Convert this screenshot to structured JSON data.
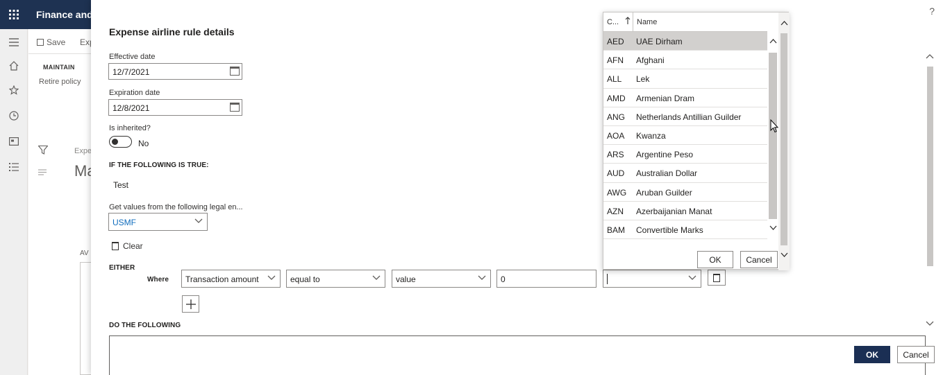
{
  "app": {
    "title": "Finance and",
    "waffle_icon": "waffle-icon"
  },
  "rail": {
    "icons": [
      "hamburger-icon",
      "home-icon",
      "star-icon",
      "clock-icon",
      "workspace-icon",
      "list-icon"
    ]
  },
  "background": {
    "toolbar": {
      "save_label": "Save",
      "exp_label": "Exp"
    },
    "maintain_label": "MAINTAIN",
    "retire_label": "Retire policy",
    "breadcrumb": "Expe",
    "heading": "Ma",
    "av_label": "AV"
  },
  "dialog": {
    "help": "?",
    "title": "Expense airline rule details",
    "effective_date": {
      "label": "Effective date",
      "value": "12/7/2021"
    },
    "expiration_date": {
      "label": "Expiration date",
      "value": "12/8/2021"
    },
    "is_inherited": {
      "label": "Is inherited?",
      "value": "No"
    },
    "if_true_label": "IF THE FOLLOWING IS TRUE:",
    "condition_name": "Test",
    "legal_entity": {
      "label": "Get values from the following legal en...",
      "value": "USMF"
    },
    "clear_label": "Clear",
    "either_label": "EITHER",
    "where_label": "Where",
    "condition": {
      "field": "Transaction amount",
      "operator": "equal to",
      "value_type": "value",
      "value": "0",
      "currency": ""
    },
    "add_icon": "plus-icon",
    "do_following_label": "DO THE FOLLOWING",
    "ok_label": "OK",
    "cancel_label": "Cancel"
  },
  "lookup": {
    "columns": {
      "code": "C...",
      "name": "Name"
    },
    "sort_icon": "sort-up-icon",
    "selected_index": 0,
    "rows": [
      {
        "code": "AED",
        "name": "UAE Dirham"
      },
      {
        "code": "AFN",
        "name": "Afghani"
      },
      {
        "code": "ALL",
        "name": "Lek"
      },
      {
        "code": "AMD",
        "name": "Armenian Dram"
      },
      {
        "code": "ANG",
        "name": "Netherlands Antillian Guilder"
      },
      {
        "code": "AOA",
        "name": "Kwanza"
      },
      {
        "code": "ARS",
        "name": "Argentine Peso"
      },
      {
        "code": "AUD",
        "name": "Australian Dollar"
      },
      {
        "code": "AWG",
        "name": "Aruban Guilder"
      },
      {
        "code": "AZN",
        "name": "Azerbaijanian Manat"
      },
      {
        "code": "BAM",
        "name": "Convertible Marks"
      }
    ],
    "ok_label": "OK",
    "cancel_label": "Cancel"
  },
  "colors": {
    "appbar": "#1e3252",
    "primary_button": "#1b2f54",
    "link_value": "#0f6cbd",
    "selected_row": "#d2d0ce"
  }
}
